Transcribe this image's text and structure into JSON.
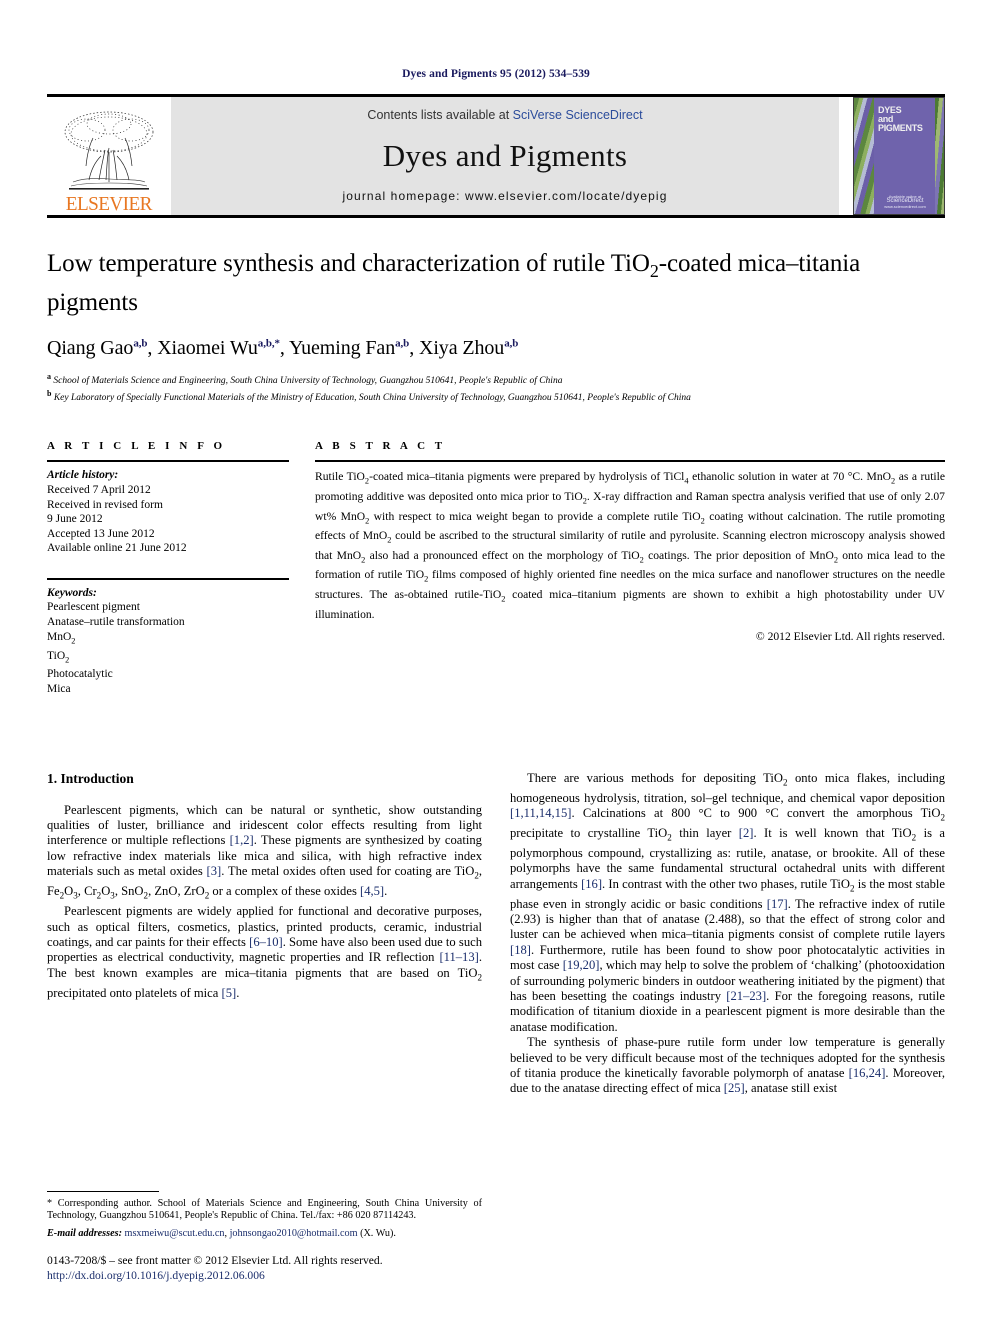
{
  "running_head": "Dyes and Pigments 95 (2012) 534–539",
  "masthead": {
    "publisher_name": "ELSEVIER",
    "contents_prefix": "Contents lists available at ",
    "contents_link": "SciVerse ScienceDirect",
    "journal_title": "Dyes and Pigments",
    "homepage": "journal homepage: www.elsevier.com/locate/dyepig",
    "cover_line1": "DYES",
    "cover_line2": "and",
    "cover_line3": "PIGMENTS",
    "cover_foot_small": "Available online at",
    "cover_foot_big": "ScienceDirect",
    "cover_foot_url": "www.sciencedirect.com"
  },
  "title": "Low temperature synthesis and characterization of rutile TiO2-coated mica–titania pigments",
  "authors": [
    {
      "name": "Qiang Gao",
      "marks": "a,b"
    },
    {
      "name": "Xiaomei Wu",
      "marks": "a,b,*"
    },
    {
      "name": "Yueming Fan",
      "marks": "a,b"
    },
    {
      "name": "Xiya Zhou",
      "marks": "a,b"
    }
  ],
  "affiliations": [
    {
      "mark": "a",
      "text": "School of Materials Science and Engineering, South China University of Technology, Guangzhou 510641, People's Republic of China"
    },
    {
      "mark": "b",
      "text": "Key Laboratory of Specially Functional Materials of the Ministry of Education, South China University of Technology, Guangzhou 510641, People's Republic of China"
    }
  ],
  "article_info": {
    "heading": "A R T I C L E   I N F O",
    "history_label": "Article history:",
    "history": [
      "Received 7 April 2012",
      "Received in revised form",
      "9 June 2012",
      "Accepted 13 June 2012",
      "Available online 21 June 2012"
    ],
    "keywords_label": "Keywords:",
    "keywords": [
      "Pearlescent pigment",
      "Anatase–rutile transformation",
      "MnO2",
      "TiO2",
      "Photocatalytic",
      "Mica"
    ]
  },
  "abstract": {
    "heading": "A B S T R A C T",
    "text": "Rutile TiO2-coated mica–titania pigments were prepared by hydrolysis of TiCl4 ethanolic solution in water at 70 °C. MnO2 as a rutile promoting additive was deposited onto mica prior to TiO2. X-ray diffraction and Raman spectra analysis verified that use of only 2.07 wt% MnO2 with respect to mica weight began to provide a complete rutile TiO2 coating without calcination. The rutile promoting effects of MnO2 could be ascribed to the structural similarity of rutile and pyrolusite. Scanning electron microscopy analysis showed that MnO2 also had a pronounced effect on the morphology of TiO2 coatings. The prior deposition of MnO2 onto mica lead to the formation of rutile TiO2 films composed of highly oriented fine needles on the mica surface and nanoflower structures on the needle structures. The as-obtained rutile-TiO2 coated mica–titanium pigments are shown to exhibit a high photostability under UV illumination.",
    "copyright": "© 2012 Elsevier Ltd. All rights reserved."
  },
  "section_heading": "1. Introduction",
  "left_column_paragraphs": [
    "Pearlescent pigments, which can be natural or synthetic, show outstanding qualities of luster, brilliance and iridescent color effects resulting from light interference or multiple reflections [1,2]. These pigments are synthesized by coating low refractive index materials like mica and silica, with high refractive index materials such as metal oxides [3]. The metal oxides often used for coating are TiO2, Fe2O3, Cr2O3, SnO2, ZnO, ZrO2 or a complex of these oxides [4,5].",
    "Pearlescent pigments are widely applied for functional and decorative purposes, such as optical filters, cosmetics, plastics, printed products, ceramic, industrial coatings, and car paints for their effects [6–10]. Some have also been used due to such properties as electrical conductivity, magnetic properties and IR reflection [11–13]. The best known examples are mica–titania pigments that are based on TiO2 precipitated onto platelets of mica [5]."
  ],
  "right_column_paragraphs": [
    "There are various methods for depositing TiO2 onto mica flakes, including homogeneous hydrolysis, titration, sol–gel technique, and chemical vapor deposition [1,11,14,15]. Calcinations at 800 °C to 900 °C convert the amorphous TiO2 precipitate to crystalline TiO2 thin layer [2]. It is well known that TiO2 is a polymorphous compound, crystallizing as: rutile, anatase, or brookite. All of these polymorphs have the same fundamental structural octahedral units with different arrangements [16]. In contrast with the other two phases, rutile TiO2 is the most stable phase even in strongly acidic or basic conditions [17]. The refractive index of rutile (2.93) is higher than that of anatase (2.488), so that the effect of strong color and luster can be achieved when mica–titania pigments consist of complete rutile layers [18]. Furthermore, rutile has been found to show poor photocatalytic activities in most case [19,20], which may help to solve the problem of ‘chalking’ (photooxidation of surrounding polymeric binders in outdoor weathering initiated by the pigment) that has been besetting the coatings industry [21–23]. For the foregoing reasons, rutile modification of titanium dioxide in a pearlescent pigment is more desirable than the anatase modification.",
    "The synthesis of phase-pure rutile form under low temperature is generally believed to be very difficult because most of the techniques adopted for the synthesis of titania produce the kinetically favorable polymorph of anatase [16,24]. Moreover, due to the anatase directing effect of mica [25], anatase still exist"
  ],
  "footnote": {
    "corresponding": "* Corresponding author. School of Materials Science and Engineering, South China University of Technology, Guangzhou 510641, People's Republic of China. Tel./fax: +86 020 87114243.",
    "email_label": "E-mail addresses:",
    "email1": "msxmeiwu@scut.edu.cn",
    "email2": "johnsongao2010@hotmail.com",
    "email_suffix": "(X. Wu)."
  },
  "footer": {
    "issn_line": "0143-7208/$ – see front matter © 2012 Elsevier Ltd. All rights reserved.",
    "doi": "http://dx.doi.org/10.1016/j.dyepig.2012.06.006"
  },
  "colors": {
    "link": "#1a2d6b",
    "elsevier_orange": "#e87722",
    "masthead_grey": "#e3e3e3",
    "cover_purple": "#6f63ac"
  }
}
